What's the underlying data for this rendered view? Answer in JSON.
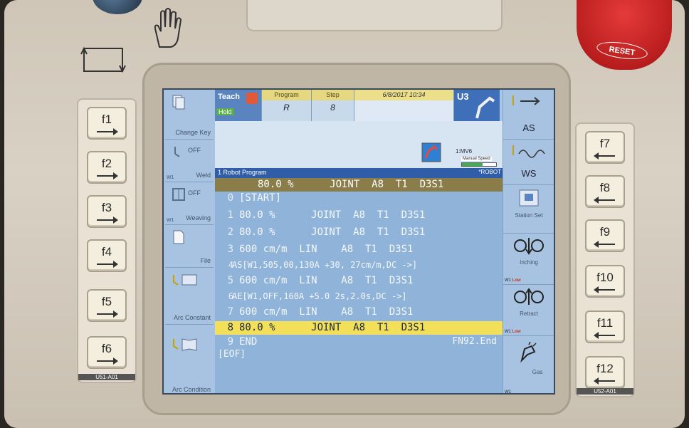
{
  "hardware": {
    "estop_label": "RESET",
    "left_keys": [
      "f1",
      "f2",
      "f3",
      "f4",
      "f5",
      "f6"
    ],
    "right_keys": [
      "f7",
      "f8",
      "f9",
      "f10",
      "f11",
      "f12"
    ],
    "left_tag": "U51-A01",
    "right_tag": "U52-A01"
  },
  "header": {
    "mode": "Teach",
    "hold": "Hold",
    "program_tab": "Program",
    "program_value": "R",
    "step_tab": "Step",
    "step_value": "8",
    "datetime": "6/8/2017  10:34",
    "robot": "U3",
    "robot_model": "1:MV6",
    "manual_speed_label": "Manual Speed",
    "manual_speed_level": 0.6
  },
  "left_softkeys": [
    {
      "label": "Change Key"
    },
    {
      "label": "Weld",
      "state": "OFF",
      "tag": "W1"
    },
    {
      "label": "Weaving",
      "state": "OFF",
      "tag": "W1"
    },
    {
      "label": "File"
    },
    {
      "label": "Arc Constant"
    },
    {
      "label": "Arc Condition"
    }
  ],
  "right_softkeys": [
    {
      "label": "AS"
    },
    {
      "label": "WS"
    },
    {
      "label": "Station Set"
    },
    {
      "label": "Inching",
      "tag": "W1",
      "level": "Low"
    },
    {
      "label": "Retract",
      "tag": "W1",
      "level": "Low"
    },
    {
      "label": "Gas",
      "tag": "W1"
    }
  ],
  "program": {
    "title": "1 Robot Program",
    "robot_tag": "*ROBOT",
    "current_line_text": "80.0 %      JOINT  A8  T1  D3S1",
    "lines": [
      {
        "n": "0",
        "t": "[START]"
      },
      {
        "n": "1",
        "t": "80.0 %      JOINT  A8  T1  D3S1"
      },
      {
        "n": "2",
        "t": "80.0 %      JOINT  A8  T1  D3S1"
      },
      {
        "n": "3",
        "t": "600 cm/m  LIN    A8  T1  D3S1"
      },
      {
        "n": "4",
        "t": "AS[W1,505,00,130A +30, 27cm/m,DC ->]"
      },
      {
        "n": "5",
        "t": "600 cm/m  LIN    A8  T1  D3S1"
      },
      {
        "n": "6",
        "t": "AE[W1,OFF,160A +5.0 2s,2.0s,DC ->]"
      },
      {
        "n": "7",
        "t": "600 cm/m  LIN    A8  T1  D3S1"
      },
      {
        "n": "8",
        "t": "80.0 %      JOINT  A8  T1  D3S1"
      },
      {
        "n": "9",
        "t": "END"
      }
    ],
    "eof": "[EOF]",
    "footer_fn": "FN92.End"
  }
}
